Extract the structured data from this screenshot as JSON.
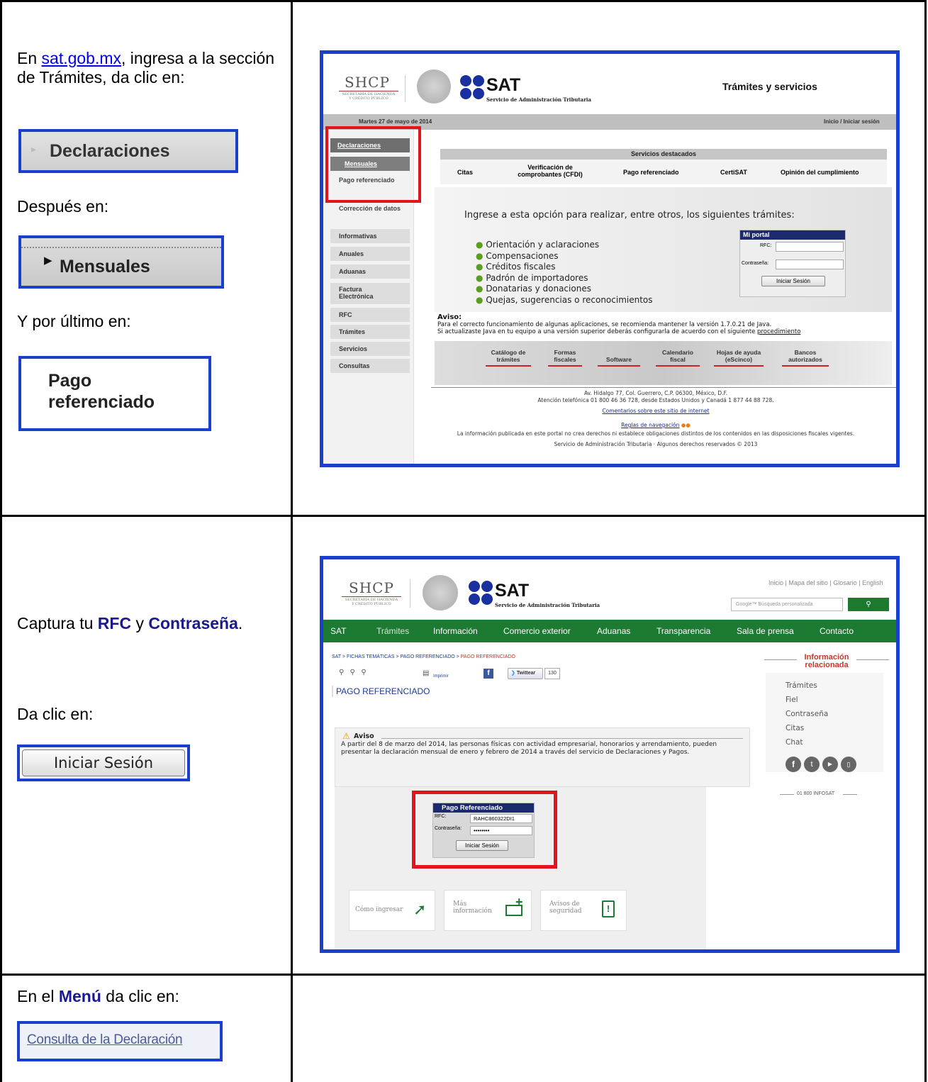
{
  "row1": {
    "left": {
      "intro_prefix": "En ",
      "link": "sat.gob.mx",
      "intro_rest": ", ingresa a la sección  de Trámites, da clic en:",
      "btn1": "Declaraciones",
      "despues": "Después en:",
      "btn2": "Mensuales",
      "ultimo": "Y por último en:",
      "btn3_line1": "Pago",
      "btn3_line2": "referenciado"
    },
    "shot": {
      "shcp": "SHCP",
      "shcp_sub1": "SECRETARÍA DE HACIENDA",
      "shcp_sub2": "Y CRÉDITO PÚBLICO",
      "sat": "SAT",
      "sat_sub": "Servicio de Administración Tributaria",
      "header_title": "Trámites y servicios",
      "date": "Martes 27 de mayo de 2014",
      "login_link": "Inicio / Iniciar sesión",
      "menu": [
        "Declaraciones",
        "Mensuales",
        "Pago referenciado",
        "Corrección de datos",
        "Informativas",
        "Anuales",
        "Aduanas",
        "Factura Electrónica",
        "RFC",
        "Trámites",
        "Servicios",
        "Consultas"
      ],
      "servicios_title": "Servicios destacados",
      "servicios": [
        "Citas",
        "Verificación de comprobantes (CFDI)",
        "Pago referenciado",
        "CertiSAT",
        "Opinión del cumplimiento"
      ],
      "ingrese": "Ingrese a esta opción para realizar, entre otros, los siguientes trámites:",
      "tramites": [
        "Orientación y aclaraciones",
        "Compensaciones",
        "Créditos fiscales",
        "Padrón de importadores",
        "Donatarias y donaciones",
        "Quejas, sugerencias o reconocimientos"
      ],
      "portal_title": "Mi portal",
      "rfc_label": "RFC:",
      "pass_label": "Contraseña:",
      "iniciar": "Iniciar Sesión",
      "aviso_title": "Aviso:",
      "aviso_1": "Para el correcto funcionamiento de algunas aplicaciones, se recomienda mantener la versión 1.7.0.21 de Java.",
      "aviso_2": "Si actualizaste Java en tu equipo a una versión superior deberás configurarla de acuerdo con el siguiente ",
      "aviso_link": "procedimiento",
      "bottom_links": [
        "Catálogo de trámites",
        "Formas fiscales",
        "Software",
        "Calendario fiscal",
        "Hojas de ayuda (eScinco)",
        "Bancos autorizados"
      ],
      "footer_1": "Av. Hidalgo 77, Col. Guerrero, C.P. 06300, México, D.F.",
      "footer_2": "Atención telefónica 01 800 46 36 728, desde Estados Unidos y Canadá 1 877 44 88 728.",
      "footer_3": "Comentarios sobre este sitio de internet",
      "footer_4": "Reglas de navegación",
      "footer_5": "La información publicada en este portal no crea derechos ni establece obligaciones distintos de los contenidos en las disposiciones fiscales vigentes.",
      "footer_6": "Servicio de Administración Tributaria · Algunos derechos reservados © 2013"
    }
  },
  "row2": {
    "left": {
      "captura_prefix": "Captura tu ",
      "rfc": "RFC",
      "y": " y ",
      "contrasena": "Contraseña",
      "dot": ".",
      "da_clic": "Da clic en:",
      "btn": "Iniciar Sesión"
    },
    "shot": {
      "top_links": "Inicio | Mapa del sitio | Glosario | English",
      "google": "Google™ Búsqueda personalizada",
      "nav": [
        "SAT",
        "Trámites",
        "Información",
        "Comercio exterior",
        "Aduanas",
        "Transparencia",
        "Sala de prensa",
        "Contacto"
      ],
      "breadcrumb": "SAT > FICHAS TEMÁTICAS > PAGO REFERENCIADO > ",
      "breadcrumb_current": "PAGO REFERENCIADO",
      "imprimir": "Imprimir",
      "twittear": "Twittear",
      "tweet_count": "130",
      "page_title": "PAGO REFERENCIADO",
      "aviso_title": "Aviso",
      "aviso_text": "A partir del 8 de marzo del 2014, las personas físicas con actividad empresarial, honorarios y arrendamiento, pueden presentar la declaración mensual de enero y febrero de 2014 a través del servicio de Declaraciones y Pagos.",
      "form_title": "Pago Referenciado",
      "rfc_label": "RFC:",
      "rfc_value": "RAHC860322DI1",
      "pass_label": "Contraseña:",
      "pass_value": "••••••••",
      "iniciar": "Iniciar Sesión",
      "tiles": [
        "Cómo ingresar",
        "Más información",
        "Avisos de seguridad"
      ],
      "info_title_1": "Información",
      "info_title_2": "relacionada",
      "info_links": [
        "Trámites",
        "Fiel",
        "Contraseña",
        "Citas",
        "Chat"
      ],
      "infosat": "01 800 INFOSAT"
    }
  },
  "row3": {
    "left": {
      "prefix": "En el ",
      "menu": "Menú",
      "rest": " da clic en:",
      "btn": "Consulta de la Declaración"
    }
  }
}
